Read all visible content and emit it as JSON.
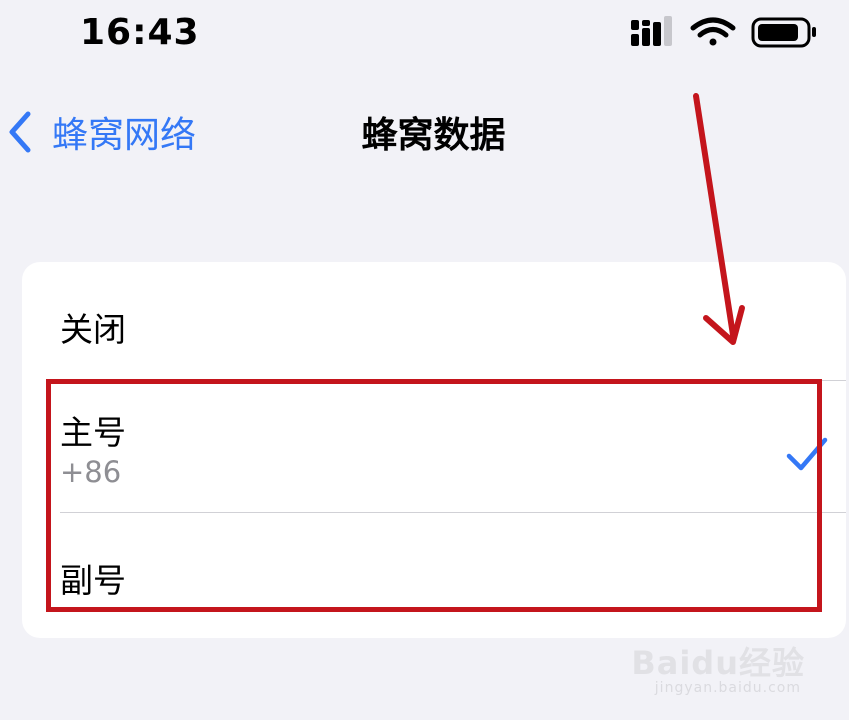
{
  "status_bar": {
    "time": "16:43",
    "icons": [
      "cellular-signal-icon",
      "wifi-icon",
      "battery-icon"
    ]
  },
  "nav": {
    "back_label": "蜂窝网络",
    "title": "蜂窝数据"
  },
  "options": [
    {
      "label": "关闭",
      "selected": false
    },
    {
      "label": "主号",
      "subtitle": "+86",
      "selected": true
    },
    {
      "label": "副号",
      "selected": false
    }
  ],
  "colors": {
    "accent": "#3478f6",
    "annotation": "#c4151c",
    "background": "#f2f2f7",
    "card": "#ffffff"
  },
  "watermark": {
    "brand": "Baidu经验",
    "url": "jingyan.baidu.com"
  }
}
